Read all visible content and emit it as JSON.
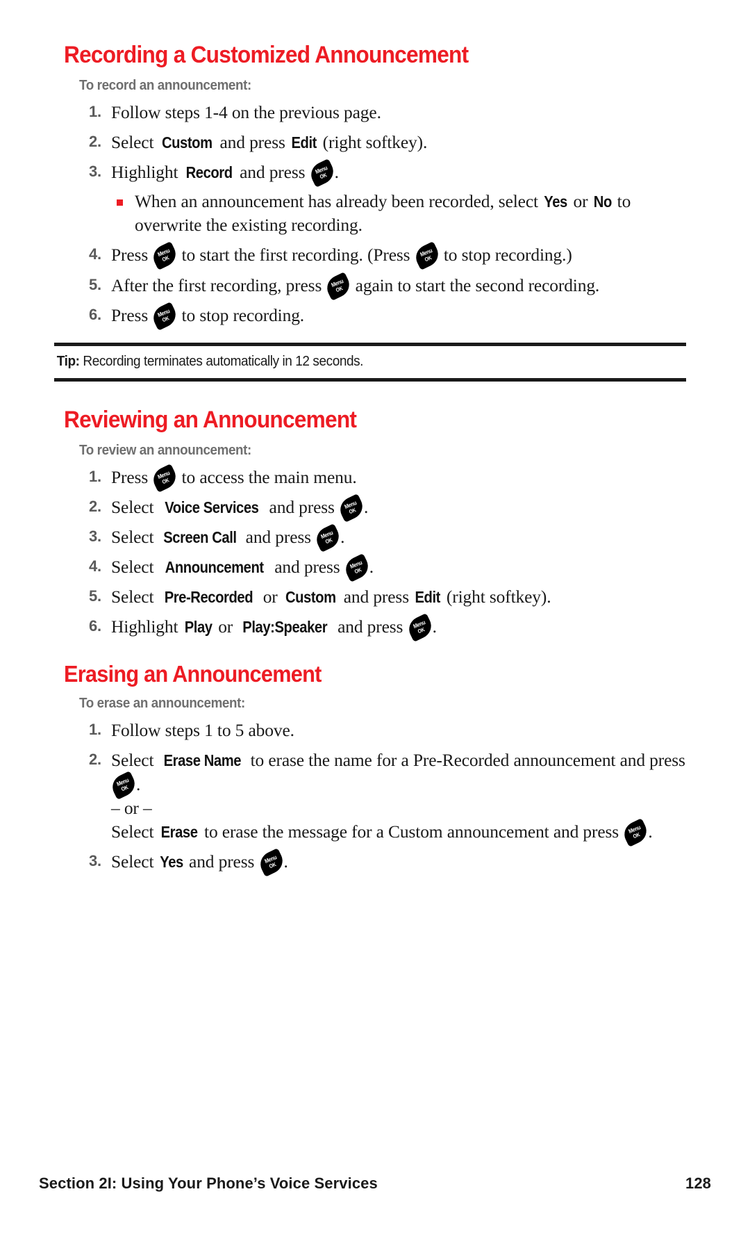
{
  "page": {
    "number": "128",
    "footer_section": "Section 2I: Using Your Phone’s Voice Services",
    "accent_color": "#ed1c24",
    "subhead_color": "#6f6f6f"
  },
  "key_glyph": {
    "name": "menu-ok-key-icon",
    "line1": "Menu",
    "line2": "OK"
  },
  "sections": [
    {
      "id": "recording",
      "title": "Recording a Customized Announcement",
      "subhead": "To record an announcement:",
      "steps": [
        {
          "num": "1.",
          "parts": [
            {
              "t": "text",
              "v": "Follow steps 1-4 on the previous page."
            }
          ]
        },
        {
          "num": "2.",
          "parts": [
            {
              "t": "text",
              "v": "Select "
            },
            {
              "t": "ui",
              "v": "Custom"
            },
            {
              "t": "text",
              "v": " and press "
            },
            {
              "t": "ui",
              "v": "Edit"
            },
            {
              "t": "text",
              "v": " (right softkey)."
            }
          ]
        },
        {
          "num": "3.",
          "parts": [
            {
              "t": "text",
              "v": "Highlight "
            },
            {
              "t": "ui",
              "v": "Record"
            },
            {
              "t": "text",
              "v": " and press "
            },
            {
              "t": "key",
              "v": ""
            },
            {
              "t": "text",
              "v": "."
            }
          ],
          "sub_bullets": [
            {
              "parts": [
                {
                  "t": "text",
                  "v": "When an announcement has already been recorded, select "
                },
                {
                  "t": "ui",
                  "v": "Yes"
                },
                {
                  "t": "text",
                  "v": " or "
                },
                {
                  "t": "ui",
                  "v": "No"
                },
                {
                  "t": "text",
                  "v": " to overwrite the existing recording."
                }
              ]
            }
          ]
        },
        {
          "num": "4.",
          "parts": [
            {
              "t": "text",
              "v": "Press "
            },
            {
              "t": "key",
              "v": ""
            },
            {
              "t": "text",
              "v": " to start the first recording. (Press "
            },
            {
              "t": "key",
              "v": ""
            },
            {
              "t": "text",
              "v": " to stop recording.)"
            }
          ]
        },
        {
          "num": "5.",
          "parts": [
            {
              "t": "text",
              "v": "After the first recording, press "
            },
            {
              "t": "key",
              "v": ""
            },
            {
              "t": "text",
              "v": " again to start the second recording."
            }
          ]
        },
        {
          "num": "6.",
          "parts": [
            {
              "t": "text",
              "v": "Press "
            },
            {
              "t": "key",
              "v": ""
            },
            {
              "t": "text",
              "v": " to stop recording."
            }
          ]
        }
      ],
      "tip": {
        "label": "Tip:",
        "text": "Recording terminates automatically in 12 seconds."
      }
    },
    {
      "id": "reviewing",
      "title": "Reviewing an Announcement",
      "subhead": "To review an announcement:",
      "steps": [
        {
          "num": "1.",
          "parts": [
            {
              "t": "text",
              "v": "Press "
            },
            {
              "t": "key",
              "v": ""
            },
            {
              "t": "text",
              "v": " to access the main menu."
            }
          ]
        },
        {
          "num": "2.",
          "parts": [
            {
              "t": "text",
              "v": "Select "
            },
            {
              "t": "ui",
              "v": "Voice Services"
            },
            {
              "t": "text",
              "v": " and press "
            },
            {
              "t": "key",
              "v": ""
            },
            {
              "t": "text",
              "v": "."
            }
          ]
        },
        {
          "num": "3.",
          "parts": [
            {
              "t": "text",
              "v": "Select "
            },
            {
              "t": "ui",
              "v": "Screen Call"
            },
            {
              "t": "text",
              "v": " and press "
            },
            {
              "t": "key",
              "v": ""
            },
            {
              "t": "text",
              "v": "."
            }
          ]
        },
        {
          "num": "4.",
          "parts": [
            {
              "t": "text",
              "v": "Select "
            },
            {
              "t": "ui",
              "v": "Announcement"
            },
            {
              "t": "text",
              "v": " and press "
            },
            {
              "t": "key",
              "v": ""
            },
            {
              "t": "text",
              "v": "."
            }
          ]
        },
        {
          "num": "5.",
          "parts": [
            {
              "t": "text",
              "v": "Select "
            },
            {
              "t": "ui",
              "v": "Pre-Recorded"
            },
            {
              "t": "text",
              "v": " or "
            },
            {
              "t": "ui",
              "v": "Custom"
            },
            {
              "t": "text",
              "v": " and press "
            },
            {
              "t": "ui",
              "v": "Edit"
            },
            {
              "t": "text",
              "v": " (right softkey)."
            }
          ]
        },
        {
          "num": "6.",
          "parts": [
            {
              "t": "text",
              "v": "Highlight "
            },
            {
              "t": "ui",
              "v": "Play"
            },
            {
              "t": "text",
              "v": " or "
            },
            {
              "t": "ui",
              "v": "Play:Speaker"
            },
            {
              "t": "text",
              "v": " and press "
            },
            {
              "t": "key",
              "v": ""
            },
            {
              "t": "text",
              "v": "."
            }
          ]
        }
      ]
    },
    {
      "id": "erasing",
      "title": "Erasing an Announcement",
      "subhead": "To erase an announcement:",
      "steps": [
        {
          "num": "1.",
          "parts": [
            {
              "t": "text",
              "v": "Follow steps 1 to 5 above."
            }
          ]
        },
        {
          "num": "2.",
          "parts": [
            {
              "t": "text",
              "v": "Select "
            },
            {
              "t": "ui",
              "v": "Erase Name"
            },
            {
              "t": "text",
              "v": " to erase the name for a Pre-Recorded announcement and press "
            },
            {
              "t": "key",
              "v": ""
            },
            {
              "t": "text",
              "v": "."
            },
            {
              "t": "br",
              "v": ""
            },
            {
              "t": "text",
              "v": "– or –"
            },
            {
              "t": "br",
              "v": ""
            },
            {
              "t": "text",
              "v": "Select "
            },
            {
              "t": "ui",
              "v": "Erase"
            },
            {
              "t": "text",
              "v": " to erase the message for a Custom announcement and press "
            },
            {
              "t": "key",
              "v": ""
            },
            {
              "t": "text",
              "v": "."
            }
          ]
        },
        {
          "num": "3.",
          "parts": [
            {
              "t": "text",
              "v": "Select "
            },
            {
              "t": "ui",
              "v": "Yes"
            },
            {
              "t": "text",
              "v": " and press "
            },
            {
              "t": "key",
              "v": ""
            },
            {
              "t": "text",
              "v": "."
            }
          ]
        }
      ]
    }
  ]
}
